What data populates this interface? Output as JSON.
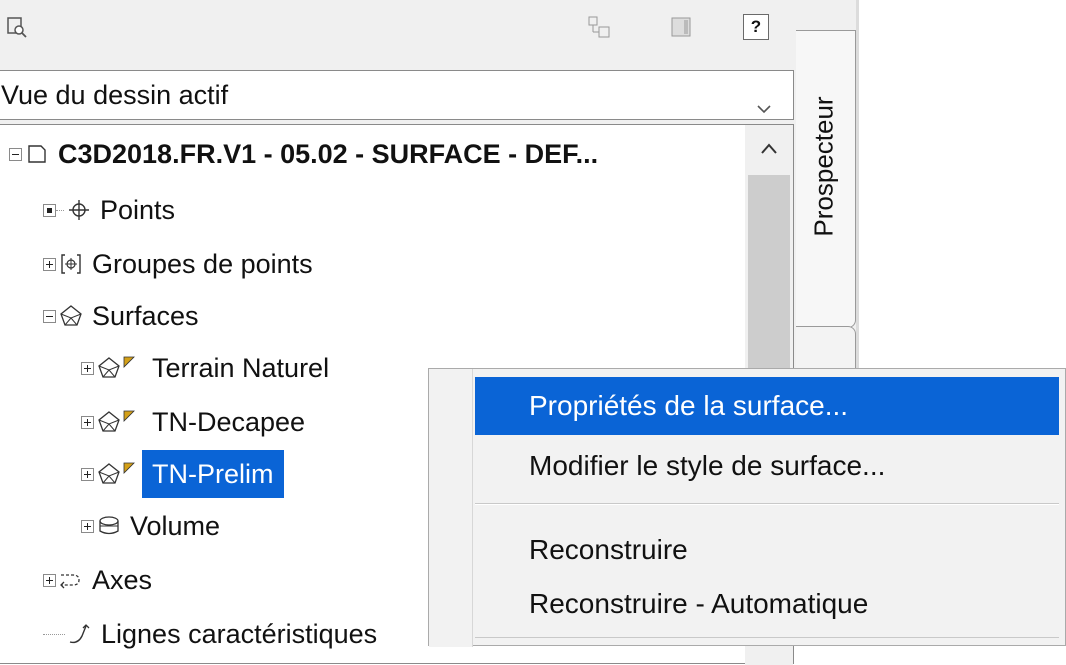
{
  "toolbar": {
    "help_label": "?"
  },
  "dropdown": {
    "value": "Vue du dessin actif"
  },
  "tree": {
    "root": "C3D2018.FR.V1 - 05.02 - SURFACE - DEF...",
    "points": "Points",
    "point_groups": "Groupes de points",
    "surfaces": "Surfaces",
    "surface_items": [
      "Terrain Naturel",
      "TN-Decapee",
      "TN-Prelim"
    ],
    "volume": "Volume",
    "axes": "Axes",
    "lines": "Lignes caractéristiques"
  },
  "side_tab": {
    "label": "Prospecteur"
  },
  "context_menu": {
    "items": [
      "Propriétés de la surface...",
      "Modifier le style de surface...",
      "Reconstruire",
      "Reconstruire - Automatique"
    ]
  },
  "colors": {
    "selection": "#0a64d6",
    "warning_flag": "#d4a017"
  }
}
